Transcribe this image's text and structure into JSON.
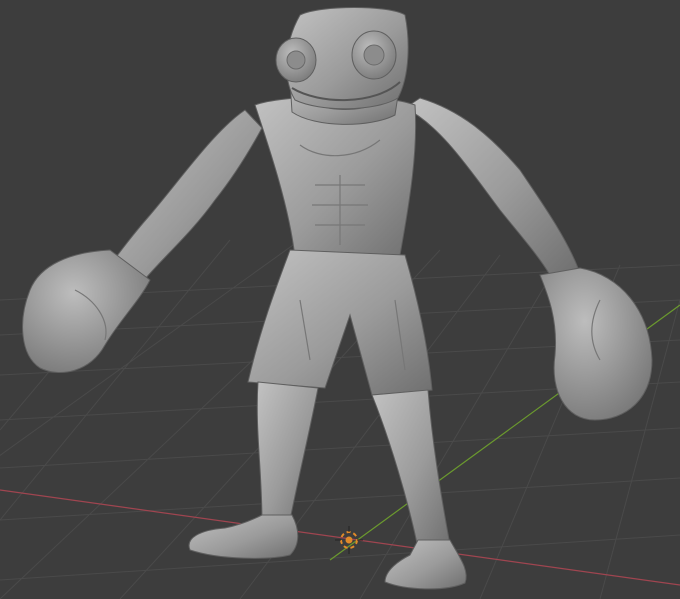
{
  "viewport": {
    "background": "#3d3d3d",
    "grid_color": "#4a4a4a",
    "x_axis_color": "#a04550",
    "y_axis_color": "#6b9a2e",
    "model_color": "#9a9a9a",
    "model_shadow": "#6e6e6e",
    "model_highlight": "#c4c4c4",
    "cursor_color": "#e08a2a"
  },
  "scene": {
    "model": "frog-boxer-sculpt",
    "cursor": "3d-cursor"
  }
}
